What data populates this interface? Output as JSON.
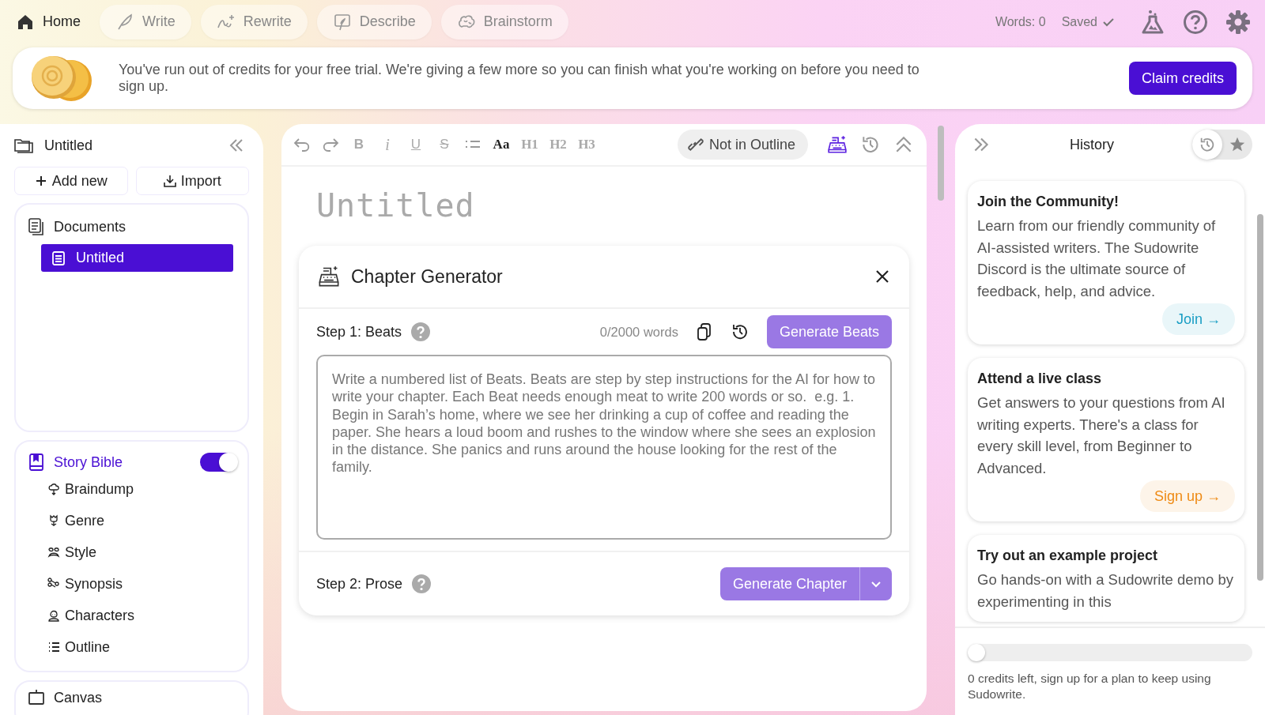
{
  "nav": {
    "tabs": [
      {
        "label": "Home",
        "kind": "home",
        "selected": true
      },
      {
        "label": "Write",
        "kind": "write",
        "selected": false
      },
      {
        "label": "Rewrite",
        "kind": "rewrite",
        "selected": false
      },
      {
        "label": "Describe",
        "kind": "describe",
        "selected": false
      },
      {
        "label": "Brainstorm",
        "kind": "brainstorm",
        "selected": false
      }
    ],
    "words": "Words: 0",
    "saved": "Saved"
  },
  "banner": {
    "message": "You've run out of credits for your free trial. We're giving a few more so you can finish what you're working on before you need to sign up.",
    "button": "Claim credits"
  },
  "sidebar": {
    "project": "Untitled",
    "actions": [
      {
        "label": "Add new",
        "kind": "add"
      },
      {
        "label": "Import",
        "kind": "import"
      }
    ],
    "documents": {
      "heading": "Documents",
      "items": [
        {
          "label": "Untitled",
          "selected": true
        }
      ]
    },
    "story_bible": {
      "heading": "Story Bible",
      "on": true,
      "items": [
        {
          "label": "Braindump",
          "kind": "braindump"
        },
        {
          "label": "Genre",
          "kind": "genre"
        },
        {
          "label": "Style",
          "kind": "style"
        },
        {
          "label": "Synopsis",
          "kind": "synopsis"
        },
        {
          "label": "Characters",
          "kind": "characters"
        },
        {
          "label": "Outline",
          "kind": "outline"
        }
      ]
    },
    "canvas": {
      "heading": "Canvas"
    }
  },
  "editor": {
    "toolbar": [
      {
        "kind": "undo"
      },
      {
        "kind": "redo"
      },
      {
        "kind": "bold",
        "label": "B"
      },
      {
        "kind": "italic",
        "label": "i"
      },
      {
        "kind": "underline",
        "label": "U"
      },
      {
        "kind": "strike",
        "label": "S"
      },
      {
        "kind": "bullets"
      },
      {
        "kind": "font",
        "label": "Aa"
      },
      {
        "kind": "heading",
        "label": "H1"
      },
      {
        "kind": "heading",
        "label": "H2"
      },
      {
        "kind": "heading",
        "label": "H3"
      }
    ],
    "outline_chip": "Not in Outline",
    "title_placeholder": "Untitled",
    "generator": {
      "title": "Chapter Generator",
      "step1": {
        "label": "Step 1: Beats",
        "word_count": "0/2000 words",
        "button": "Generate Beats",
        "placeholder": "Write a numbered list of Beats. Beats are step by step instructions for the AI for how to write your chapter. Each Beat needs enough meat to write 200 words or so.  e.g. 1. Begin in Sarah’s home, where we see her drinking a cup of coffee and reading the paper. She hears a loud boom and rushes to the window where she sees an explosion in the distance. She panics and runs around the house looking for the rest of the family."
      },
      "step2": {
        "label": "Step 2: Prose",
        "button": "Generate Chapter"
      }
    }
  },
  "history": {
    "title": "History",
    "tabs": [
      {
        "kind": "history",
        "selected": true
      },
      {
        "kind": "starred",
        "selected": false
      }
    ],
    "cards": [
      {
        "title": "Join the Community!",
        "body": "Learn from our friendly community of AI-assisted writers. The Sudowrite Discord is the ultimate source of feedback, help, and advice.",
        "button": "Join →",
        "color": "#1a9ec4"
      },
      {
        "title": "Attend a live class",
        "body": "Get answers to your questions from AI writing experts. There's a class for every skill level, from Beginner to Advanced.",
        "button": "Sign up →",
        "color": "#ee8a14"
      },
      {
        "title": "Try out an example project",
        "body": "Go hands-on with a Sudowrite demo by experimenting in this"
      }
    ],
    "credits": {
      "level": 0,
      "text": "0 credits left, sign up for a plan to keep using Sudowrite."
    }
  }
}
